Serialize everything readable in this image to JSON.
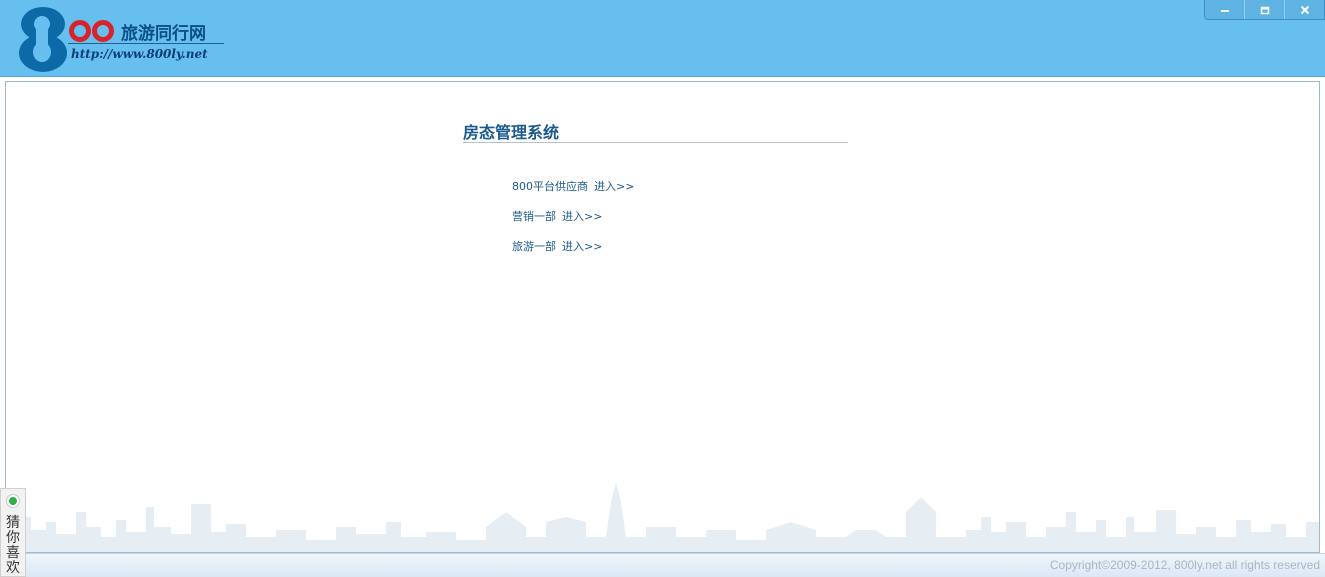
{
  "header": {
    "logo_name": "旅游同行网",
    "logo_url": "http://www.800ly.net"
  },
  "window_controls": {
    "icons": [
      "minimize-icon",
      "restore-icon",
      "close-icon"
    ]
  },
  "main": {
    "title": "房态管理系统",
    "entries": [
      {
        "label": "800平台供应商",
        "action": "进入>>"
      },
      {
        "label": "营销一部",
        "action": "进入>>"
      },
      {
        "label": "旅游一部",
        "action": "进入>>"
      }
    ]
  },
  "footer": {
    "copyright": "Copyright©2009-2012, 800ly.net all rights reserved"
  },
  "side_widget": {
    "label": "猜你喜欢"
  },
  "colors": {
    "header_bg": "#66bfee",
    "brand_blue": "#0c4f87",
    "brand_red": "#d8232a",
    "link": "#1c5a8a"
  }
}
